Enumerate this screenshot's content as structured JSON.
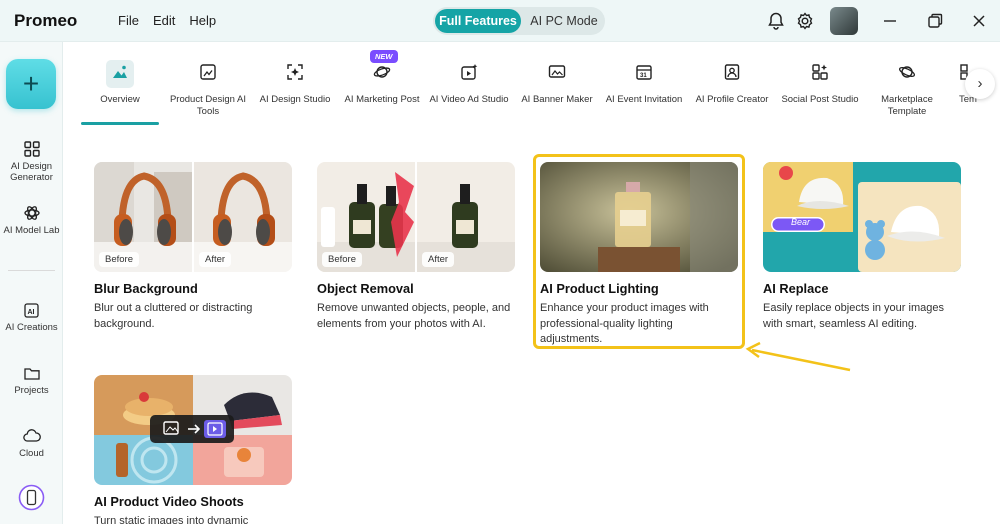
{
  "app": {
    "logo": "Promeo",
    "menu": [
      "File",
      "Edit",
      "Help"
    ],
    "modes": {
      "full": "Full Features",
      "pc": "AI PC Mode"
    }
  },
  "sidebar": {
    "add_label": "+",
    "items": [
      {
        "label": "AI Design Generator"
      },
      {
        "label": "AI Model Lab"
      },
      {
        "label": "AI Creations"
      },
      {
        "label": "Projects"
      },
      {
        "label": "Cloud"
      }
    ]
  },
  "tabs": {
    "items": [
      {
        "label": "Overview"
      },
      {
        "label": "Product Design AI Tools"
      },
      {
        "label": "AI Design Studio"
      },
      {
        "label": "AI Marketing Post"
      },
      {
        "label": "AI Video Ad Studio"
      },
      {
        "label": "AI Banner Maker"
      },
      {
        "label": "AI Event Invitation"
      },
      {
        "label": "AI Profile Creator"
      },
      {
        "label": "Social Post Studio"
      },
      {
        "label": "Marketplace Template"
      },
      {
        "label": "Tem"
      }
    ],
    "new_badge": "NEW",
    "next": "›"
  },
  "cards": [
    {
      "title": "Blur Background",
      "desc": "Blur out a cluttered or distracting background.",
      "before": "Before",
      "after": "After"
    },
    {
      "title": "Object Removal",
      "desc": "Remove unwanted objects, people, and elements from your photos with AI.",
      "before": "Before",
      "after": "After"
    },
    {
      "title": "AI Product Lighting",
      "desc": "Enhance your product images with professional-quality lighting adjustments."
    },
    {
      "title": "AI Replace",
      "desc": "Easily replace objects in your images with smart, seamless AI editing.",
      "chip": "Bear"
    },
    {
      "title": "AI Product Video Shoots",
      "desc": "Turn static images into dynamic"
    }
  ],
  "colors": {
    "accent": "#15a4a6",
    "highlight": "#f3c219",
    "badge": "#7a4dff"
  }
}
